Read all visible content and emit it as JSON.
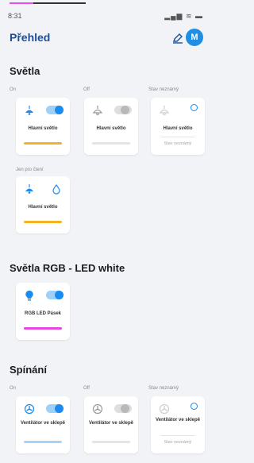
{
  "status_bar": {
    "time": "8:31",
    "icons": "▂▄▆ ≋ ▬"
  },
  "header": {
    "title": "Přehled",
    "avatar_letter": "M"
  },
  "sections": [
    {
      "title": "Světla",
      "groups": [
        {
          "label": "On",
          "card": {
            "name": "Hlavní světlo",
            "state": "on",
            "bar_color": "#f2b325"
          }
        },
        {
          "label": "Off",
          "card": {
            "name": "Hlavní světlo",
            "state": "off",
            "bar_color": "#e4e4e4"
          }
        },
        {
          "label": "Stav neznámý",
          "card": {
            "name": "Hlavní světlo",
            "state": "unknown",
            "status_text": "Stav neznámý"
          }
        },
        {
          "label": "Jen pro čtení",
          "card": {
            "name": "Hlavní světlo",
            "state": "readonly",
            "bar_color": "#f2b325"
          }
        }
      ]
    },
    {
      "title": "Světla RGB - LED white",
      "groups": [
        {
          "label": "",
          "card": {
            "name": "RGB LED Pásek",
            "state": "on",
            "bar_color": "#e548dd"
          }
        }
      ]
    },
    {
      "title": "Spínání",
      "groups": [
        {
          "label": "On",
          "card": {
            "name": "Ventilátor ve sklepě",
            "state": "on",
            "bar_color": "#a7d3f7"
          }
        },
        {
          "label": "Off",
          "card": {
            "name": "Ventilátor ve sklepě",
            "state": "off",
            "bar_color": "#e4e4e4"
          }
        },
        {
          "label": "Stav neznámý",
          "card": {
            "name": "Ventilátor ve sklepě",
            "state": "unknown",
            "status_text": "Stav neznámý"
          }
        }
      ]
    }
  ],
  "colors": {
    "accent": "#1a8bf0",
    "title_blue": "#1d4f9a",
    "light_on": "#f2b325",
    "rgb": "#e548dd"
  },
  "icons": [
    "ceiling-lamp-icon",
    "ceiling-lamp-off-icon",
    "drop-icon",
    "bulb-icon",
    "fan-icon",
    "pen-icon",
    "info-icon"
  ]
}
